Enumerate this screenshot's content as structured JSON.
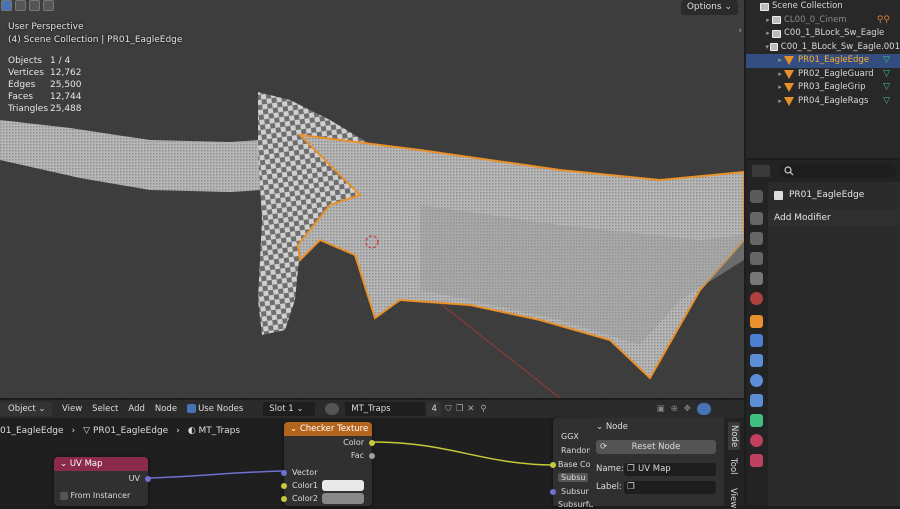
{
  "viewport": {
    "perspective_label": "User Perspective",
    "context_label": "(4) Scene Collection | PR01_EagleEdge",
    "stats": [
      {
        "key": "Objects",
        "value": "1 / 4"
      },
      {
        "key": "Vertices",
        "value": "12,762"
      },
      {
        "key": "Edges",
        "value": "25,500"
      },
      {
        "key": "Faces",
        "value": "12,744"
      },
      {
        "key": "Triangles",
        "value": "25,488"
      }
    ],
    "options_label": "Options",
    "options_arrow": "⌄",
    "collapse_arrow": "‹"
  },
  "outliner": {
    "rows": [
      {
        "label": "Scene Collection",
        "twisty": "",
        "icon": "collection"
      },
      {
        "label": "CL00_0_Cinem",
        "twisty": "▸",
        "icon": "collection",
        "dim": true,
        "tag": "⚲⚲"
      },
      {
        "label": "C00_1_BLock_Sw_Eagle",
        "twisty": "▸",
        "icon": "collection",
        "dim": false
      },
      {
        "label": "C00_1_BLock_Sw_Eagle.001",
        "twisty": "▾",
        "icon": "collection",
        "dim": false
      },
      {
        "label": "PR01_EagleEdge",
        "twisty": "▸",
        "icon": "mesh",
        "selected": true,
        "tag": "▽"
      },
      {
        "label": "PR02_EagleGuard",
        "twisty": "▸",
        "icon": "mesh",
        "tag": "▽"
      },
      {
        "label": "PR03_EagleGrip",
        "twisty": "▸",
        "icon": "mesh",
        "tag": "▽"
      },
      {
        "label": "PR04_EagleRags",
        "twisty": "▸",
        "icon": "mesh",
        "tag": "▽"
      }
    ]
  },
  "properties": {
    "object_name": "PR01_EagleEdge",
    "add_modifier_label": "Add Modifier"
  },
  "node_header": {
    "mode": "Object",
    "menus": [
      "View",
      "Select",
      "Add",
      "Node"
    ],
    "use_nodes_label": "Use Nodes",
    "slot_label": "Slot 1",
    "material_name": "MT_Traps",
    "user_count": "4"
  },
  "breadcrumb": {
    "items": [
      "01_EagleEdge",
      "PR01_EagleEdge",
      "MT_Traps"
    ],
    "separators": [
      "›",
      "›"
    ]
  },
  "nodes": {
    "uv_map": {
      "title": "UV Map",
      "output": "UV",
      "checkbox_label": "From Instancer"
    },
    "checker": {
      "title": "Checker Texture",
      "outputs": [
        "Color",
        "Fac"
      ],
      "inputs": [
        "Vector",
        "Color1",
        "Color2"
      ],
      "color1": "#e8e8e8",
      "color2": "#888888"
    },
    "principled_partial": {
      "lines": [
        "GGX",
        "Random",
        "Base Co",
        "Subsu",
        "Subsur",
        "Subsurfa"
      ]
    }
  },
  "npanel": {
    "section": "Node",
    "reset_label": "Reset Node",
    "name_label": "Name:",
    "name_value": "UV Map",
    "label_label": "Label:",
    "label_value": "",
    "tabs": [
      "Node",
      "Tool",
      "View"
    ]
  },
  "colors": {
    "selection_orange": "#e8902b",
    "selected_row": "#334d80",
    "uv_header": "#8a2b4a",
    "texture_header": "#b5641e",
    "link_yellow": "#c8c83c",
    "link_purple": "#7070d0"
  }
}
